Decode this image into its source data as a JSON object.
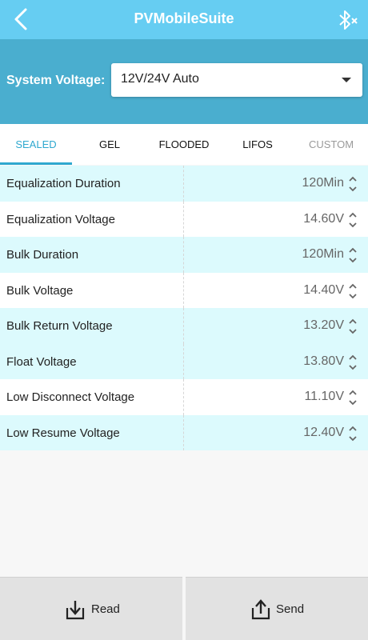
{
  "header": {
    "title": "PVMobileSuite",
    "back_icon": "back-chevron-icon",
    "bluetooth_icon": "bluetooth-disconnected-icon"
  },
  "system_voltage": {
    "label": "System Voltage:",
    "value": "12V/24V Auto"
  },
  "tabs": [
    {
      "label": "SEALED",
      "state": "active"
    },
    {
      "label": "GEL",
      "state": "normal"
    },
    {
      "label": "FLOODED",
      "state": "normal"
    },
    {
      "label": "LIFOS",
      "state": "normal"
    },
    {
      "label": "CUSTOM",
      "state": "disabled"
    }
  ],
  "settings": [
    {
      "label": "Equalization Duration",
      "value": "120Min"
    },
    {
      "label": "Equalization Voltage",
      "value": "14.60V"
    },
    {
      "label": "Bulk Duration",
      "value": "120Min"
    },
    {
      "label": "Bulk Voltage",
      "value": "14.40V"
    },
    {
      "label": "Bulk Return Voltage",
      "value": "13.20V"
    },
    {
      "label": "Float Voltage",
      "value": "13.80V"
    },
    {
      "label": "Low Disconnect Voltage",
      "value": "11.10V"
    },
    {
      "label": "Low Resume Voltage",
      "value": "12.40V"
    }
  ],
  "actions": {
    "read_label": "Read",
    "send_label": "Send"
  },
  "colors": {
    "header": "#66cdf2",
    "voltage_bar": "#4aaecf",
    "accent": "#2fa8cf",
    "row_alt": "#dcfafd"
  }
}
